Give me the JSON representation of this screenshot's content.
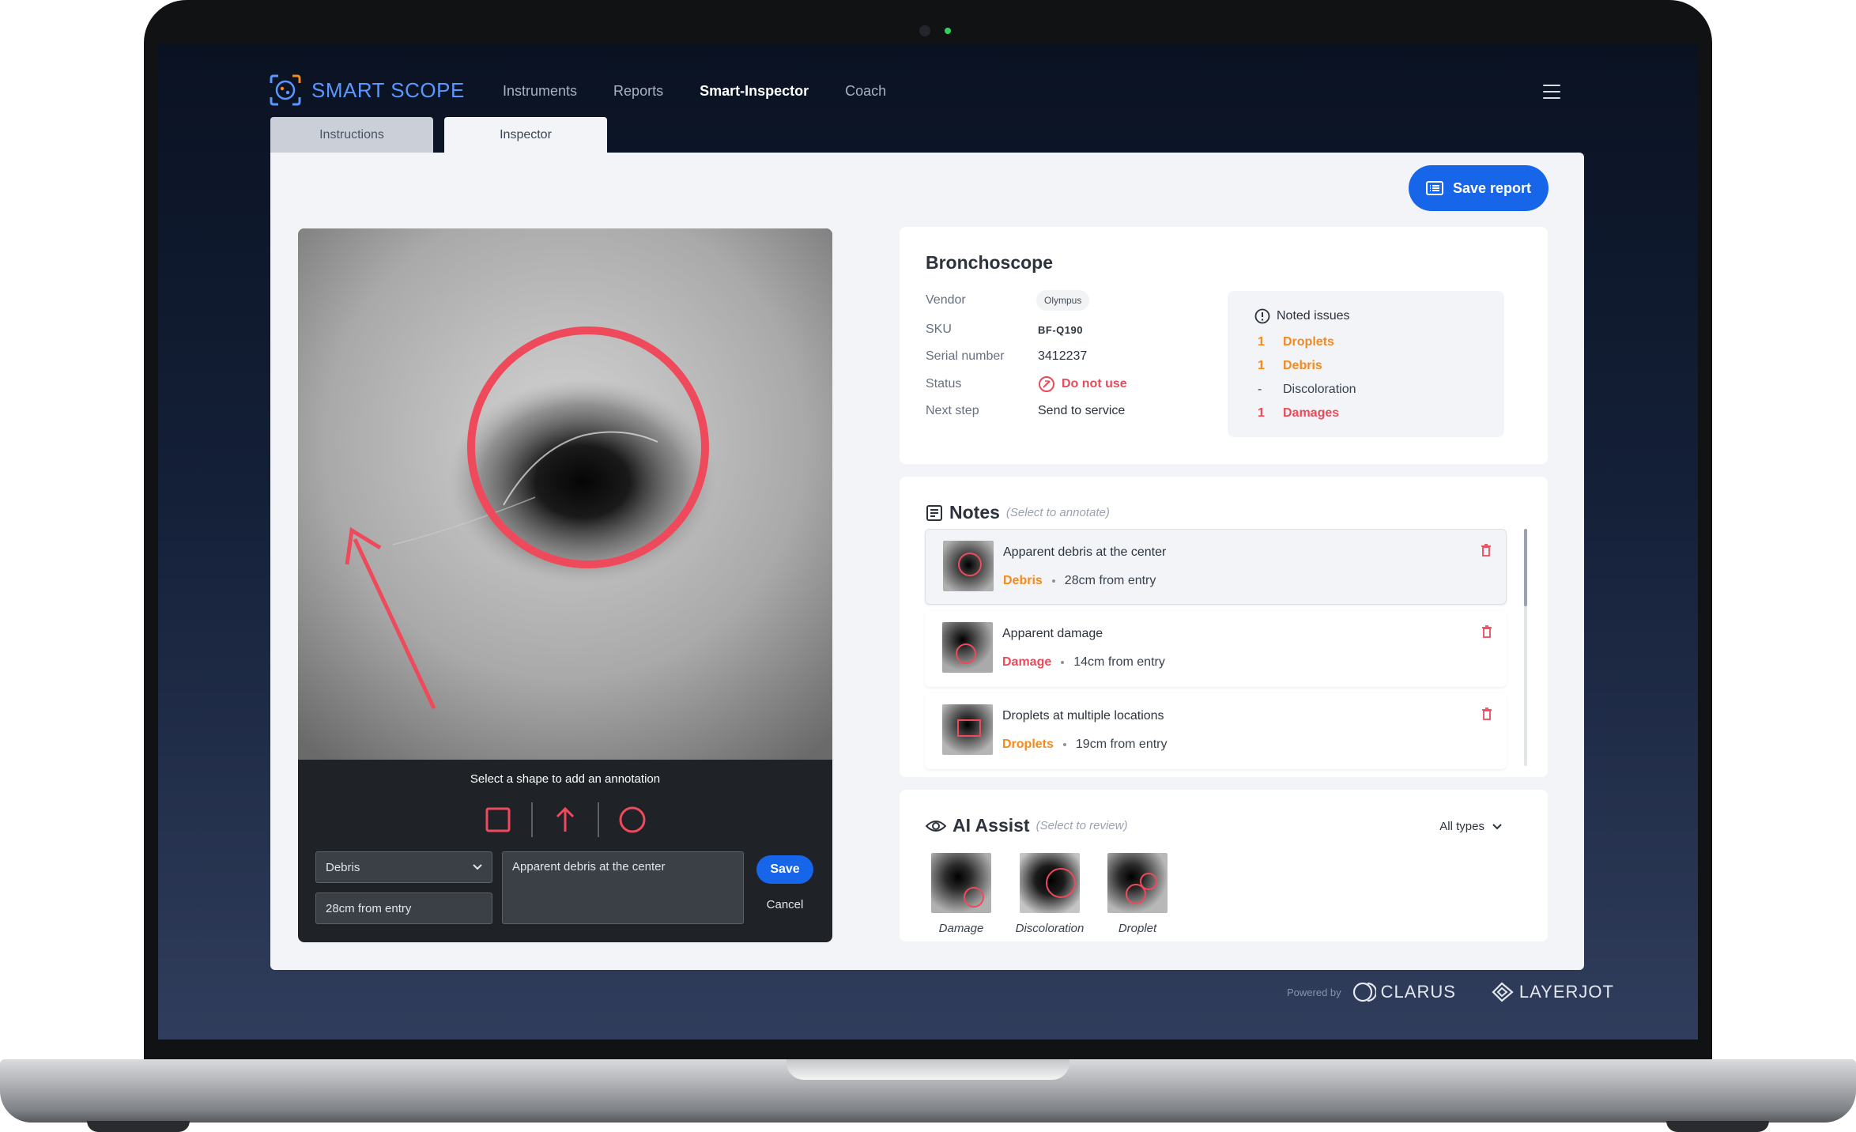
{
  "brand": {
    "name": "SMART SCOPE"
  },
  "nav": {
    "items": [
      "Instruments",
      "Reports",
      "Smart-Inspector",
      "Coach"
    ],
    "active": "Smart-Inspector"
  },
  "tabs": {
    "instructions": "Instructions",
    "inspector": "Inspector"
  },
  "actions": {
    "save_report": "Save report"
  },
  "annotation": {
    "prompt": "Select a shape to add an annotation",
    "tools": [
      "square-icon",
      "arrow-up-icon",
      "circle-icon"
    ],
    "type_value": "Debris",
    "location_value": "28cm from entry",
    "note_value": "Apparent debris at the center",
    "save_label": "Save",
    "cancel_label": "Cancel"
  },
  "instrument": {
    "title": "Bronchoscope",
    "vendor_label": "Vendor",
    "vendor": "Olympus",
    "sku_label": "SKU",
    "sku": "BF-Q190",
    "serial_label": "Serial number",
    "serial": "3412237",
    "status_label": "Status",
    "status": "Do not use",
    "next_label": "Next step",
    "next": "Send to service"
  },
  "issues": {
    "title": "Noted issues",
    "items": [
      {
        "count": "1",
        "name": "Droplets",
        "color": "#f28a1e"
      },
      {
        "count": "1",
        "name": "Debris",
        "color": "#f28a1e"
      },
      {
        "count": "-",
        "name": "Discoloration",
        "color": "#3a424d"
      },
      {
        "count": "1",
        "name": "Damages",
        "color": "#ea4a5a"
      }
    ]
  },
  "notes": {
    "title": "Notes",
    "hint": "(Select to annotate)",
    "items": [
      {
        "title": "Apparent debris at the center",
        "tag": "Debris",
        "location": "28cm from entry"
      },
      {
        "title": "Apparent damage",
        "tag": "Damage",
        "location": "14cm from entry"
      },
      {
        "title": "Droplets at multiple locations",
        "tag": "Droplets",
        "location": "19cm from entry"
      }
    ]
  },
  "ai": {
    "title": "AI Assist",
    "hint": "(Select to review)",
    "filter": "All types",
    "items": [
      "Damage",
      "Discoloration",
      "Droplet"
    ]
  },
  "footer": {
    "powered": "Powered by",
    "brand1": "CLARUS",
    "brand2": "LAYERJOT"
  },
  "colors": {
    "accent": "#1766ea",
    "annotation": "#ea4a5a",
    "warning": "#f28a1e"
  }
}
